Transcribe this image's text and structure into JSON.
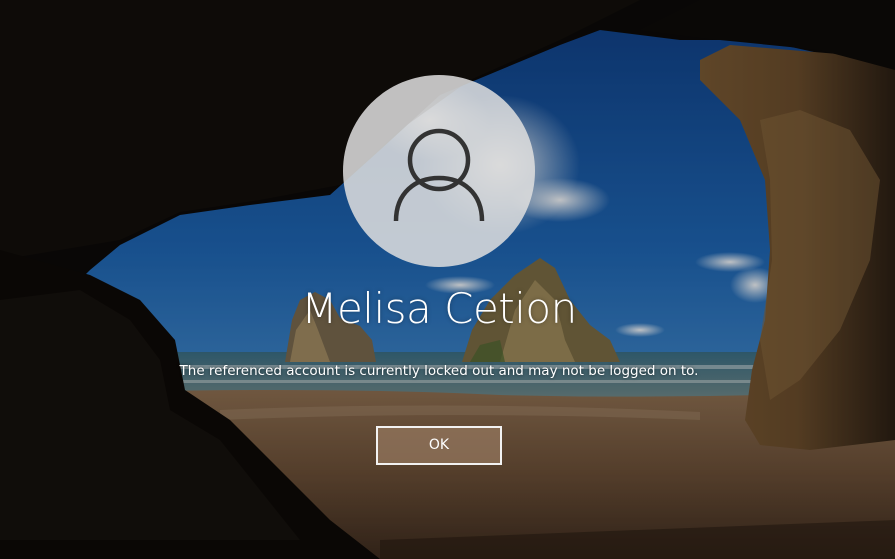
{
  "login": {
    "user_name": "Melisa Cetion",
    "message": "The referenced account is currently locked out and may not be logged on to.",
    "ok_label": "OK"
  },
  "icons": {
    "avatar": "user-avatar-icon"
  },
  "colors": {
    "text": "#ffffff",
    "button_border": "#f2f2f2",
    "avatar_bg": "#dedede"
  }
}
